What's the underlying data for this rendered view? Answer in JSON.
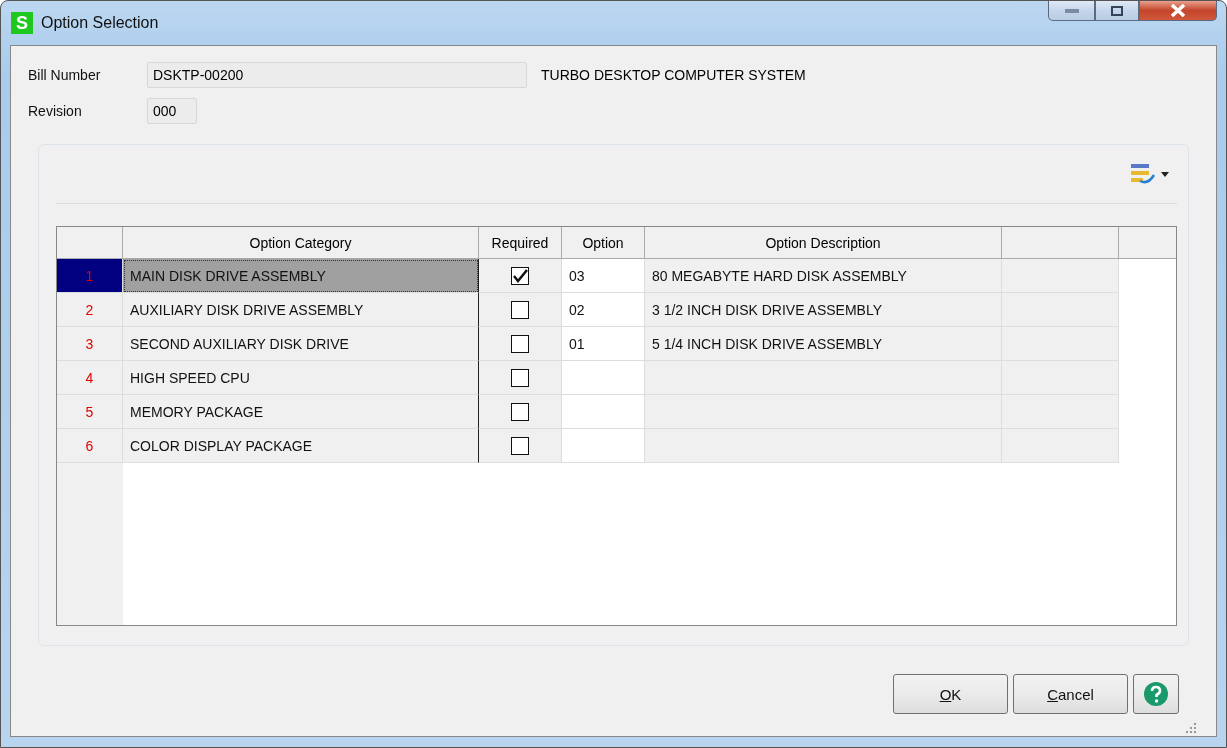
{
  "window": {
    "title": "Option Selection",
    "app_icon_letter": "S"
  },
  "header": {
    "bill_number": {
      "label": "Bill Number",
      "value": "DSKTP-00200",
      "description": "TURBO DESKTOP COMPUTER SYSTEM"
    },
    "revision": {
      "label": "Revision",
      "value": "000"
    }
  },
  "table": {
    "columns": [
      "Option Category",
      "Required",
      "Option",
      "Option Description"
    ],
    "rows": [
      {
        "number": "1",
        "category": "MAIN DISK DRIVE ASSEMBLY",
        "required": true,
        "option": "03",
        "description": "80 MEGABYTE HARD DISK ASSEMBLY",
        "selected": true
      },
      {
        "number": "2",
        "category": "AUXILIARY DISK DRIVE ASSEMBLY",
        "required": false,
        "option": "02",
        "description": "3 1/2 INCH DISK DRIVE ASSEMBLY",
        "selected": false
      },
      {
        "number": "3",
        "category": "SECOND AUXILIARY DISK DRIVE",
        "required": false,
        "option": "01",
        "description": "5 1/4 INCH DISK DRIVE ASSEMBLY",
        "selected": false
      },
      {
        "number": "4",
        "category": "HIGH SPEED CPU",
        "required": false,
        "option": "",
        "description": "",
        "selected": false
      },
      {
        "number": "5",
        "category": "MEMORY PACKAGE",
        "required": false,
        "option": "",
        "description": "",
        "selected": false
      },
      {
        "number": "6",
        "category": "COLOR DISPLAY PACKAGE",
        "required": false,
        "option": "",
        "description": "",
        "selected": false
      }
    ]
  },
  "buttons": [
    {
      "label": "OK"
    },
    {
      "label": "Cancel"
    }
  ]
}
